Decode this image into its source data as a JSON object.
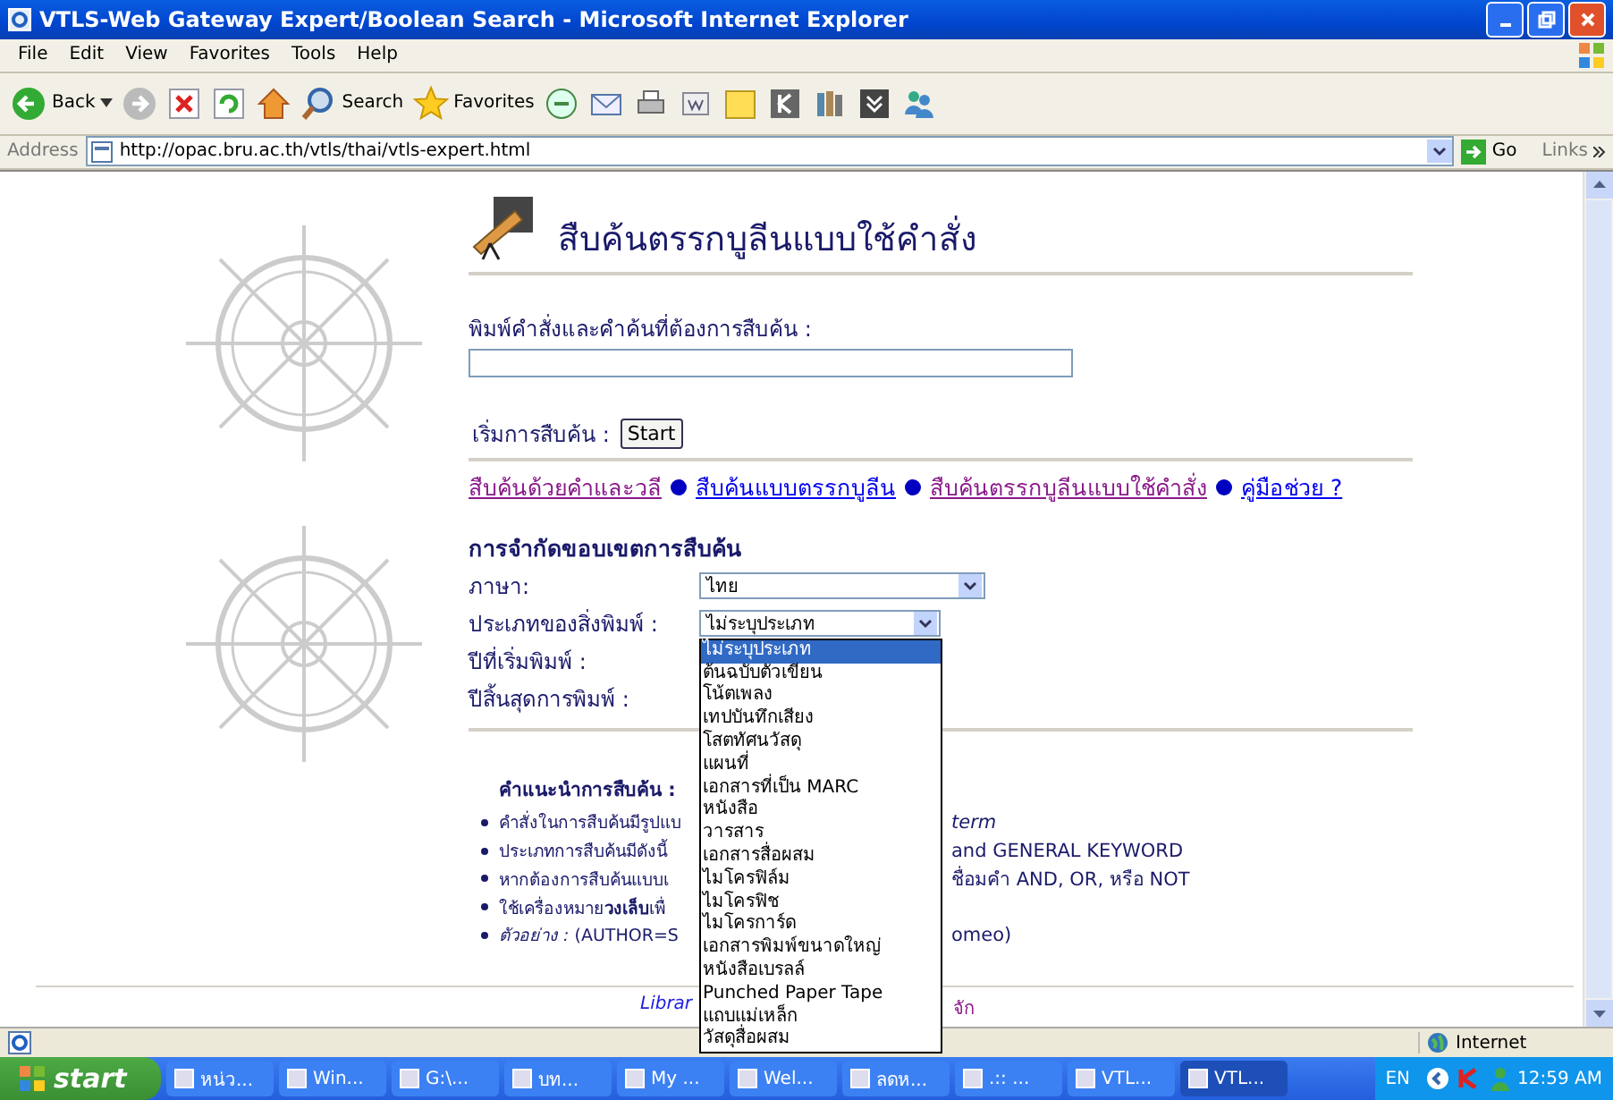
{
  "window": {
    "title": "VTLS-Web Gateway Expert/Boolean Search - Microsoft Internet Explorer"
  },
  "menu": [
    "File",
    "Edit",
    "View",
    "Favorites",
    "Tools",
    "Help"
  ],
  "toolbar": {
    "back": "Back",
    "search": "Search",
    "favorites": "Favorites"
  },
  "address": {
    "label": "Address",
    "url": "http://opac.bru.ac.th/vtls/thai/vtls-expert.html",
    "go": "Go",
    "links": "Links"
  },
  "page": {
    "heading": "สืบค้นตรรกบูลีนแบบใช้คำสั่ง",
    "query_label": "พิมพ์คำสั่งและคำค้นที่ต้องการสืบค้น :",
    "start_label": "เริ่มการสืบค้น :",
    "start_button": "Start",
    "links": [
      {
        "label": "สืบค้นด้วยคำและวลี",
        "visited": true
      },
      {
        "label": "สืบค้นแบบตรรกบูลีน",
        "visited": false
      },
      {
        "label": "สืบค้นตรรกบูลีนแบบใช้คำสั่ง",
        "visited": true
      },
      {
        "label": "คู่มือช่วย ?",
        "visited": false
      }
    ],
    "limits": {
      "title": "การจำกัดขอบเขตการสืบค้น",
      "rows": [
        {
          "label": "ภาษา:",
          "kind": "select",
          "value": "ไทย"
        },
        {
          "label": "ประเภทของสิ่งพิมพ์ :",
          "kind": "select",
          "value": "ไม่ระบุประเภท"
        },
        {
          "label": "ปีที่เริ่มพิมพ์ :",
          "kind": "label"
        },
        {
          "label": "ปีสิ้นสุดการพิมพ์ :",
          "kind": "label"
        }
      ]
    },
    "dropdown": [
      {
        "label": "ไม่ระบุประเภท",
        "selected": true
      },
      {
        "label": "ต้นฉบับตัวเขียน",
        "selected": false
      },
      {
        "label": "โน้ตเพลง",
        "selected": false
      },
      {
        "label": "เทปบันทึกเสียง",
        "selected": false
      },
      {
        "label": "โสตทัศนวัสดุ",
        "selected": false
      },
      {
        "label": "แผนที่",
        "selected": false
      },
      {
        "label": "เอกสารที่เป็น MARC",
        "selected": false
      },
      {
        "label": "หนังสือ",
        "selected": false
      },
      {
        "label": "วารสาร",
        "selected": false
      },
      {
        "label": "เอกสารสื่อผสม",
        "selected": false
      },
      {
        "label": "ไมโครฟิล์ม",
        "selected": false
      },
      {
        "label": "ไมโครฟิช",
        "selected": false
      },
      {
        "label": "ไมโครการ์ด",
        "selected": false
      },
      {
        "label": "เอกสารพิมพ์ขนาดใหญ่",
        "selected": false
      },
      {
        "label": "หนังสือเบรลล์",
        "selected": false
      },
      {
        "label": "Punched Paper Tape",
        "selected": false
      },
      {
        "label": "แถบแม่เหล็ก",
        "selected": false
      },
      {
        "label": "วัสดุสื่อผสม",
        "selected": false
      }
    ],
    "hints": {
      "heading": "คำแนะนำการสืบค้น :",
      "items": [
        {
          "left": "คำสั่งในการสืบค้นมีรูปแบ",
          "right": "*term*"
        },
        {
          "left": "ประเภทการสืบค้นมีดังนี้",
          "right": "and GENERAL KEYWORD"
        },
        {
          "left": "หากต้องการสืบค้นแบบเ",
          "right": "ชื่อมคำ AND, OR, หรือ NOT"
        },
        {
          "left": "ใช้เครื่องหมาย**วงเล็บ**เพื่"
        },
        {
          "left": "*ตัวอย่าง :* (AUTHOR=S",
          "right": "omeo)"
        }
      ]
    },
    "footer": {
      "left": "Librar",
      "right": "จัก"
    }
  },
  "status_bar": {
    "zone": "Internet"
  },
  "taskbar": {
    "start": "start",
    "tasks": [
      {
        "label": "หน่ว...",
        "selected": false
      },
      {
        "label": "Win...",
        "selected": false
      },
      {
        "label": "G:\\...",
        "selected": false
      },
      {
        "label": "บท...",
        "selected": false
      },
      {
        "label": "My ...",
        "selected": false
      },
      {
        "label": "Wel...",
        "selected": false
      },
      {
        "label": "ลดห...",
        "selected": false
      },
      {
        "label": ".:: ...",
        "selected": false
      },
      {
        "label": "VTL...",
        "selected": false
      },
      {
        "label": "VTL...",
        "selected": true
      }
    ],
    "language": "EN",
    "clock": "12:59 AM"
  }
}
